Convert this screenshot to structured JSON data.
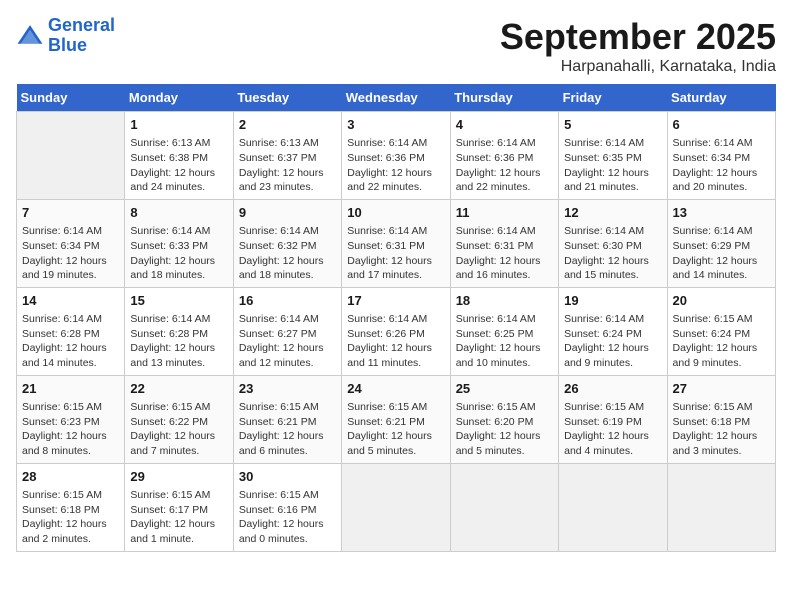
{
  "logo": {
    "line1": "General",
    "line2": "Blue"
  },
  "title": "September 2025",
  "subtitle": "Harpanahalli, Karnataka, India",
  "days_header": [
    "Sunday",
    "Monday",
    "Tuesday",
    "Wednesday",
    "Thursday",
    "Friday",
    "Saturday"
  ],
  "weeks": [
    [
      {
        "num": "",
        "text": ""
      },
      {
        "num": "1",
        "text": "Sunrise: 6:13 AM\nSunset: 6:38 PM\nDaylight: 12 hours\nand 24 minutes."
      },
      {
        "num": "2",
        "text": "Sunrise: 6:13 AM\nSunset: 6:37 PM\nDaylight: 12 hours\nand 23 minutes."
      },
      {
        "num": "3",
        "text": "Sunrise: 6:14 AM\nSunset: 6:36 PM\nDaylight: 12 hours\nand 22 minutes."
      },
      {
        "num": "4",
        "text": "Sunrise: 6:14 AM\nSunset: 6:36 PM\nDaylight: 12 hours\nand 22 minutes."
      },
      {
        "num": "5",
        "text": "Sunrise: 6:14 AM\nSunset: 6:35 PM\nDaylight: 12 hours\nand 21 minutes."
      },
      {
        "num": "6",
        "text": "Sunrise: 6:14 AM\nSunset: 6:34 PM\nDaylight: 12 hours\nand 20 minutes."
      }
    ],
    [
      {
        "num": "7",
        "text": "Sunrise: 6:14 AM\nSunset: 6:34 PM\nDaylight: 12 hours\nand 19 minutes."
      },
      {
        "num": "8",
        "text": "Sunrise: 6:14 AM\nSunset: 6:33 PM\nDaylight: 12 hours\nand 18 minutes."
      },
      {
        "num": "9",
        "text": "Sunrise: 6:14 AM\nSunset: 6:32 PM\nDaylight: 12 hours\nand 18 minutes."
      },
      {
        "num": "10",
        "text": "Sunrise: 6:14 AM\nSunset: 6:31 PM\nDaylight: 12 hours\nand 17 minutes."
      },
      {
        "num": "11",
        "text": "Sunrise: 6:14 AM\nSunset: 6:31 PM\nDaylight: 12 hours\nand 16 minutes."
      },
      {
        "num": "12",
        "text": "Sunrise: 6:14 AM\nSunset: 6:30 PM\nDaylight: 12 hours\nand 15 minutes."
      },
      {
        "num": "13",
        "text": "Sunrise: 6:14 AM\nSunset: 6:29 PM\nDaylight: 12 hours\nand 14 minutes."
      }
    ],
    [
      {
        "num": "14",
        "text": "Sunrise: 6:14 AM\nSunset: 6:28 PM\nDaylight: 12 hours\nand 14 minutes."
      },
      {
        "num": "15",
        "text": "Sunrise: 6:14 AM\nSunset: 6:28 PM\nDaylight: 12 hours\nand 13 minutes."
      },
      {
        "num": "16",
        "text": "Sunrise: 6:14 AM\nSunset: 6:27 PM\nDaylight: 12 hours\nand 12 minutes."
      },
      {
        "num": "17",
        "text": "Sunrise: 6:14 AM\nSunset: 6:26 PM\nDaylight: 12 hours\nand 11 minutes."
      },
      {
        "num": "18",
        "text": "Sunrise: 6:14 AM\nSunset: 6:25 PM\nDaylight: 12 hours\nand 10 minutes."
      },
      {
        "num": "19",
        "text": "Sunrise: 6:14 AM\nSunset: 6:24 PM\nDaylight: 12 hours\nand 9 minutes."
      },
      {
        "num": "20",
        "text": "Sunrise: 6:15 AM\nSunset: 6:24 PM\nDaylight: 12 hours\nand 9 minutes."
      }
    ],
    [
      {
        "num": "21",
        "text": "Sunrise: 6:15 AM\nSunset: 6:23 PM\nDaylight: 12 hours\nand 8 minutes."
      },
      {
        "num": "22",
        "text": "Sunrise: 6:15 AM\nSunset: 6:22 PM\nDaylight: 12 hours\nand 7 minutes."
      },
      {
        "num": "23",
        "text": "Sunrise: 6:15 AM\nSunset: 6:21 PM\nDaylight: 12 hours\nand 6 minutes."
      },
      {
        "num": "24",
        "text": "Sunrise: 6:15 AM\nSunset: 6:21 PM\nDaylight: 12 hours\nand 5 minutes."
      },
      {
        "num": "25",
        "text": "Sunrise: 6:15 AM\nSunset: 6:20 PM\nDaylight: 12 hours\nand 5 minutes."
      },
      {
        "num": "26",
        "text": "Sunrise: 6:15 AM\nSunset: 6:19 PM\nDaylight: 12 hours\nand 4 minutes."
      },
      {
        "num": "27",
        "text": "Sunrise: 6:15 AM\nSunset: 6:18 PM\nDaylight: 12 hours\nand 3 minutes."
      }
    ],
    [
      {
        "num": "28",
        "text": "Sunrise: 6:15 AM\nSunset: 6:18 PM\nDaylight: 12 hours\nand 2 minutes."
      },
      {
        "num": "29",
        "text": "Sunrise: 6:15 AM\nSunset: 6:17 PM\nDaylight: 12 hours\nand 1 minute."
      },
      {
        "num": "30",
        "text": "Sunrise: 6:15 AM\nSunset: 6:16 PM\nDaylight: 12 hours\nand 0 minutes."
      },
      {
        "num": "",
        "text": ""
      },
      {
        "num": "",
        "text": ""
      },
      {
        "num": "",
        "text": ""
      },
      {
        "num": "",
        "text": ""
      }
    ]
  ]
}
